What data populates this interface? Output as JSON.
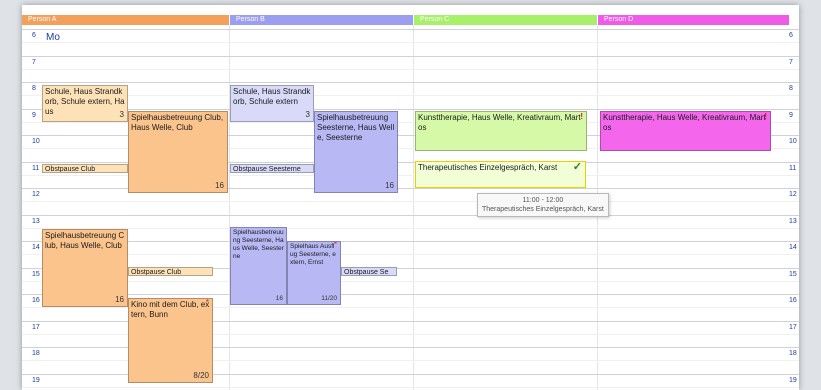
{
  "persons": [
    {
      "label": "Person A",
      "color": "#f2a05a"
    },
    {
      "label": "Person B",
      "color": "#9c9ef0"
    },
    {
      "label": "Person C",
      "color": "#a6f06a"
    },
    {
      "label": "Person D",
      "color": "#ef5ae6"
    }
  ],
  "day_label": "Mo",
  "hours_left": [
    "6",
    "7",
    "8",
    "9",
    "10",
    "11",
    "12",
    "13",
    "14",
    "15",
    "16",
    "17",
    "18",
    "19"
  ],
  "hours_right": [
    "6",
    "7",
    "8",
    "9",
    "10",
    "11",
    "12",
    "13",
    "14",
    "15",
    "16",
    "17",
    "18",
    "19"
  ],
  "events": {
    "a_schule": {
      "text": "Schule, Haus Strandkorb, Schule extern, Haus",
      "num": "3"
    },
    "a_spiel1": {
      "text": "Spielhausbetreuung Club, Haus Welle, Club",
      "num": "16"
    },
    "a_obst1": {
      "text": "Obstpause Club"
    },
    "a_spiel2": {
      "text": "Spielhausbetreuung Club, Haus Welle, Club",
      "num": "16"
    },
    "a_obst2": {
      "text": "Obstpause Club"
    },
    "a_kino": {
      "text": "Kino mit dem Club, extern, Bunn",
      "num": "8/20",
      "star": "*"
    },
    "b_schule": {
      "text": "Schule, Haus Strandkorb, Schule extern",
      "num": "3"
    },
    "b_spiel1": {
      "text": "Spielhausbetreuung Seesterne, Haus Welle, Seesterne",
      "num": "16"
    },
    "b_obst1": {
      "text": "Obstpause Seesterne"
    },
    "b_spiel2": {
      "text": "Spielhausbetreuung Seesterne, Haus Welle, Seesterne",
      "num": "16"
    },
    "b_ausflug": {
      "text": "Spielhaus Ausflug Seesterne, extern, Ernst",
      "num": "11/20",
      "star": "*"
    },
    "b_obst2": {
      "text": "Obstpause Se"
    },
    "c_kunst": {
      "text": "Kunsttherapie, Haus Welle, Kreativraum, Martos",
      "bang": "!"
    },
    "c_thera": {
      "text": "Therapeutisches Einzelgespräch, Karst",
      "check": "✓"
    },
    "d_kunst": {
      "text": "Kunsttherapie, Haus Welle, Kreativraum, Martos",
      "bang": "!"
    }
  },
  "tooltip": {
    "time": "11:00 - 12:00",
    "title": "Therapeutisches Einzelgespräch, Karst"
  }
}
